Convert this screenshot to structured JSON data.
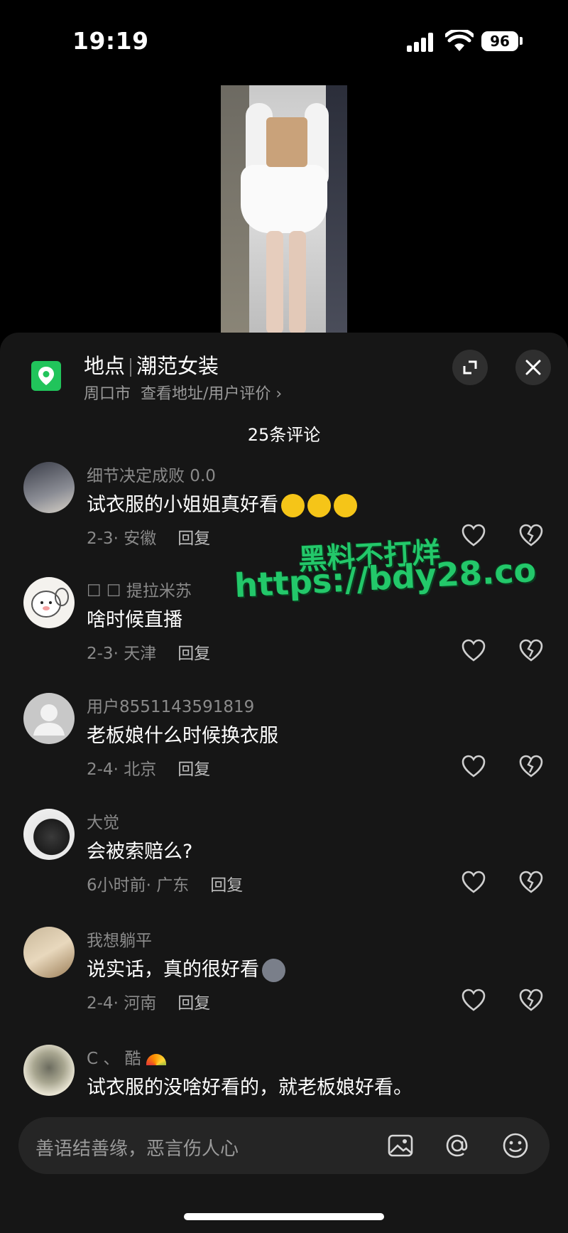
{
  "status_bar": {
    "time": "19:19",
    "battery": "96"
  },
  "location": {
    "label": "地点",
    "name": "潮范女装",
    "city": "周口市",
    "action": "查看地址/用户评价 ›"
  },
  "comments_header": "25条评论",
  "comments": [
    {
      "user": "细节决定成败 0.0",
      "text": "试衣服的小姐姐真好看",
      "date": "2-3",
      "region": "安徽",
      "reply": "回复"
    },
    {
      "user": "☐ ☐ 提拉米苏",
      "text": "啥时候直播",
      "date": "2-3",
      "region": "天津",
      "reply": "回复"
    },
    {
      "user": "用户8551143591819",
      "text": "老板娘什么时候换衣服",
      "date": "2-4",
      "region": "北京",
      "reply": "回复"
    },
    {
      "user": "大觉",
      "text": "会被索赔么?",
      "date": "6小时前",
      "region": "广东",
      "reply": "回复"
    },
    {
      "user": "我想躺平",
      "text": "说实话，真的很好看",
      "date": "2-4",
      "region": "河南",
      "reply": "回复"
    },
    {
      "user": "C 、 酷",
      "text": "试衣服的没啥好看的，就老板娘好看。"
    }
  ],
  "watermark": {
    "line1": "黑料不打烊",
    "line2": "https://bdy28.co"
  },
  "input": {
    "placeholder": "善语结善缘，恶言伤人心"
  },
  "colors": {
    "location_green": "#21c45b",
    "watermark_green": "#23c86a",
    "sheet_bg": "#161616"
  }
}
